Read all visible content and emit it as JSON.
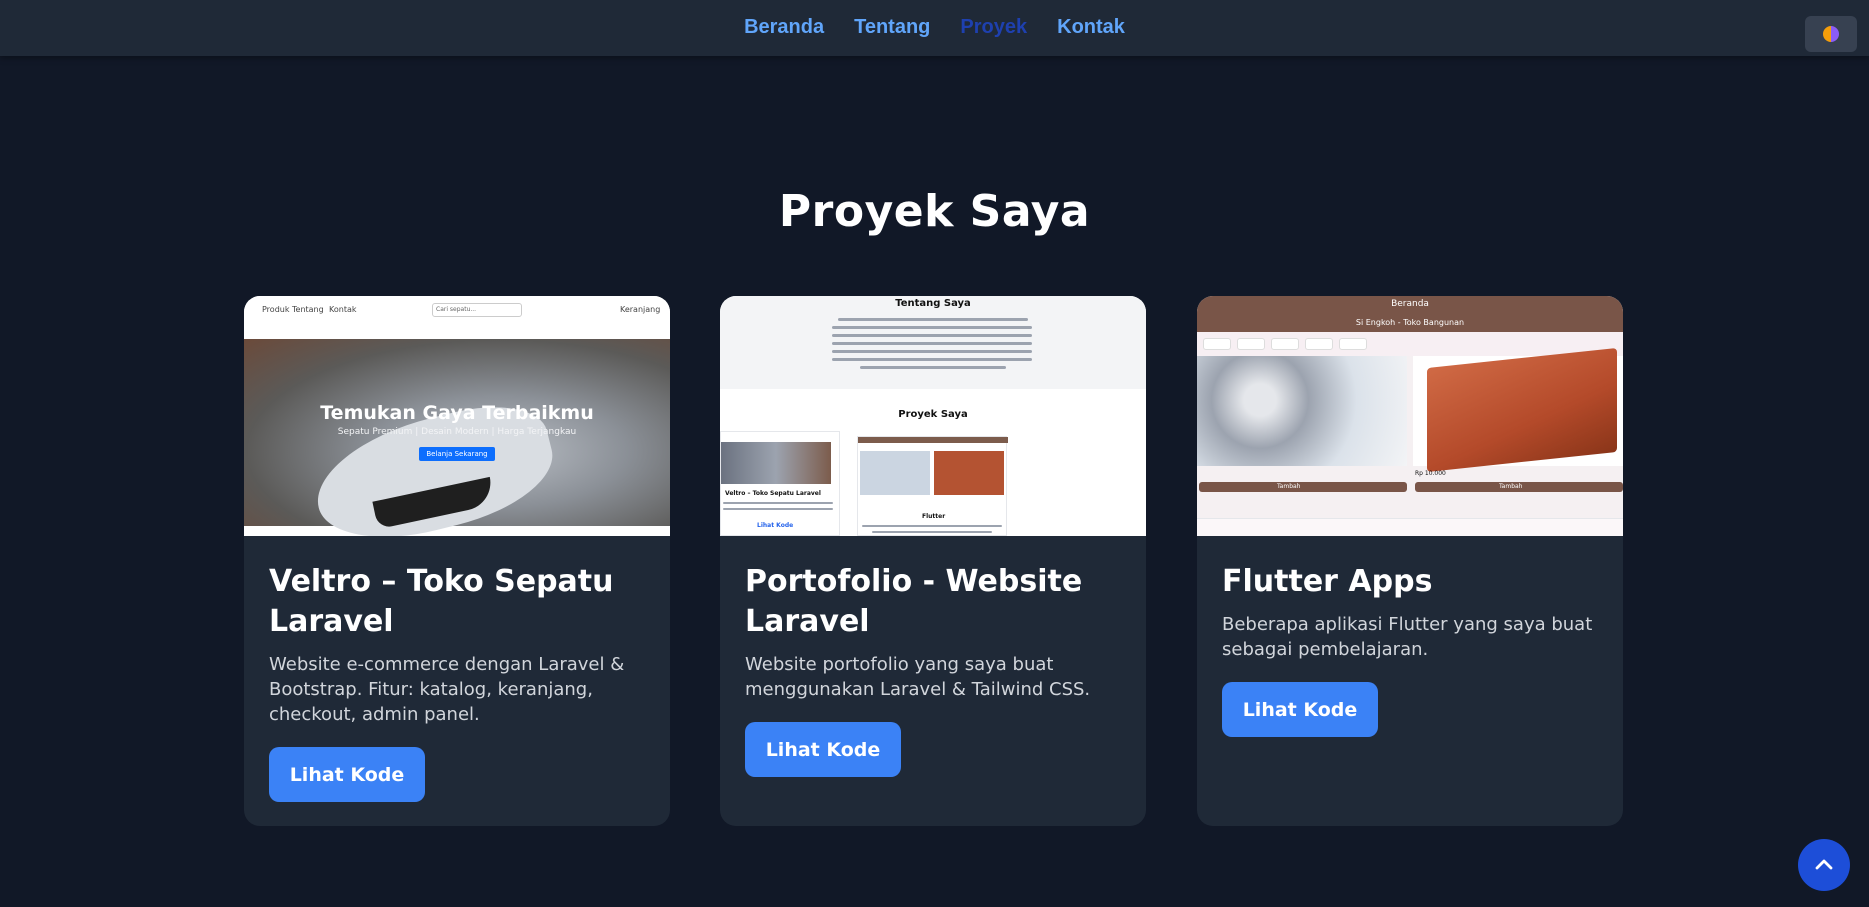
{
  "nav": {
    "items": [
      "Beranda",
      "Tentang",
      "Proyek",
      "Kontak"
    ],
    "active": "Proyek"
  },
  "theme_toggle_icon": "half-circle-theme-icon",
  "section": {
    "title": "Proyek Saya"
  },
  "projects": [
    {
      "title": "Veltro – Toko Sepatu Laravel",
      "description": "Website e-commerce dengan Laravel & Bootstrap. Fitur: katalog, keranjang, checkout, admin panel.",
      "button_label": "Lihat Kode",
      "thumbnail": {
        "nav_items": [
          "Produk",
          "Tentang",
          "Kontak"
        ],
        "search_placeholder": "Cari sepatu...",
        "cart_label": "Keranjang",
        "hero_title": "Temukan Gaya Terbaikmu",
        "hero_subtitle": "Sepatu Premium | Desain Modern | Harga Terjangkau",
        "hero_button": "Belanja Sekarang"
      }
    },
    {
      "title": "Portofolio - Website Laravel",
      "description": "Website portofolio yang saya buat menggunakan Laravel & Tailwind CSS.",
      "button_label": "Lihat Kode",
      "thumbnail": {
        "top_title": "Tentang Saya",
        "section_title": "Proyek Saya",
        "mini_card_1_title": "Veltro – Toko Sepatu Laravel",
        "mini_card_2_title": "Flutter",
        "mini_link": "Lihat Kode"
      }
    },
    {
      "title": "Flutter Apps",
      "description": "Beberapa aplikasi Flutter yang saya buat sebagai pembelajaran.",
      "button_label": "Lihat Kode",
      "thumbnail": {
        "appbar_title": "Beranda",
        "appbar_subtitle": "Si Engkoh - Toko Bangunan",
        "item_1_price": "Rp 10.000",
        "button_label": "Tambah"
      }
    }
  ],
  "scroll_top_icon": "chevron-up-icon",
  "colors": {
    "background": "#111827",
    "card": "#1f2937",
    "accent": "#3b82f6",
    "nav_link": "#60a5fa",
    "nav_active": "#1e40af"
  }
}
